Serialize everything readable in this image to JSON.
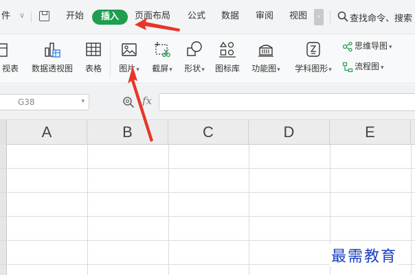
{
  "menubar": {
    "file_partial": "件",
    "tabs": [
      {
        "label": "开始"
      },
      {
        "label": "插入"
      },
      {
        "label": "页面布局"
      },
      {
        "label": "公式"
      },
      {
        "label": "数据"
      },
      {
        "label": "审阅"
      },
      {
        "label": "视图"
      }
    ],
    "more_glyph": "›",
    "search_text": "查找命令、搜索"
  },
  "ribbon": {
    "items": [
      {
        "label": "视表",
        "icon": "pivot-table-icon"
      },
      {
        "label": "数据透视图",
        "icon": "pivot-chart-icon"
      },
      {
        "label": "表格",
        "icon": "table-icon"
      },
      {
        "label": "图片",
        "icon": "picture-icon"
      },
      {
        "label": "截屏",
        "icon": "screenshot-icon"
      },
      {
        "label": "形状",
        "icon": "shape-icon"
      },
      {
        "label": "图标库",
        "icon": "icon-library-icon"
      },
      {
        "label": "功能图",
        "icon": "function-chart-icon"
      },
      {
        "label": "学科图形",
        "icon": "subject-graphic-icon"
      }
    ],
    "mindmap_label": "思维导图",
    "flowchart_label": "流程图",
    "dropdown_glyph": "▾"
  },
  "formula_bar": {
    "cell_ref": "G38",
    "fx_label": "fx",
    "formula_value": ""
  },
  "grid": {
    "columns": [
      "A",
      "B",
      "C",
      "D",
      "E"
    ]
  },
  "watermark": "最需教育",
  "colors": {
    "accent_green": "#1e9e4f",
    "arrow_red": "#e8352a",
    "watermark_blue": "#1a3fbf"
  }
}
